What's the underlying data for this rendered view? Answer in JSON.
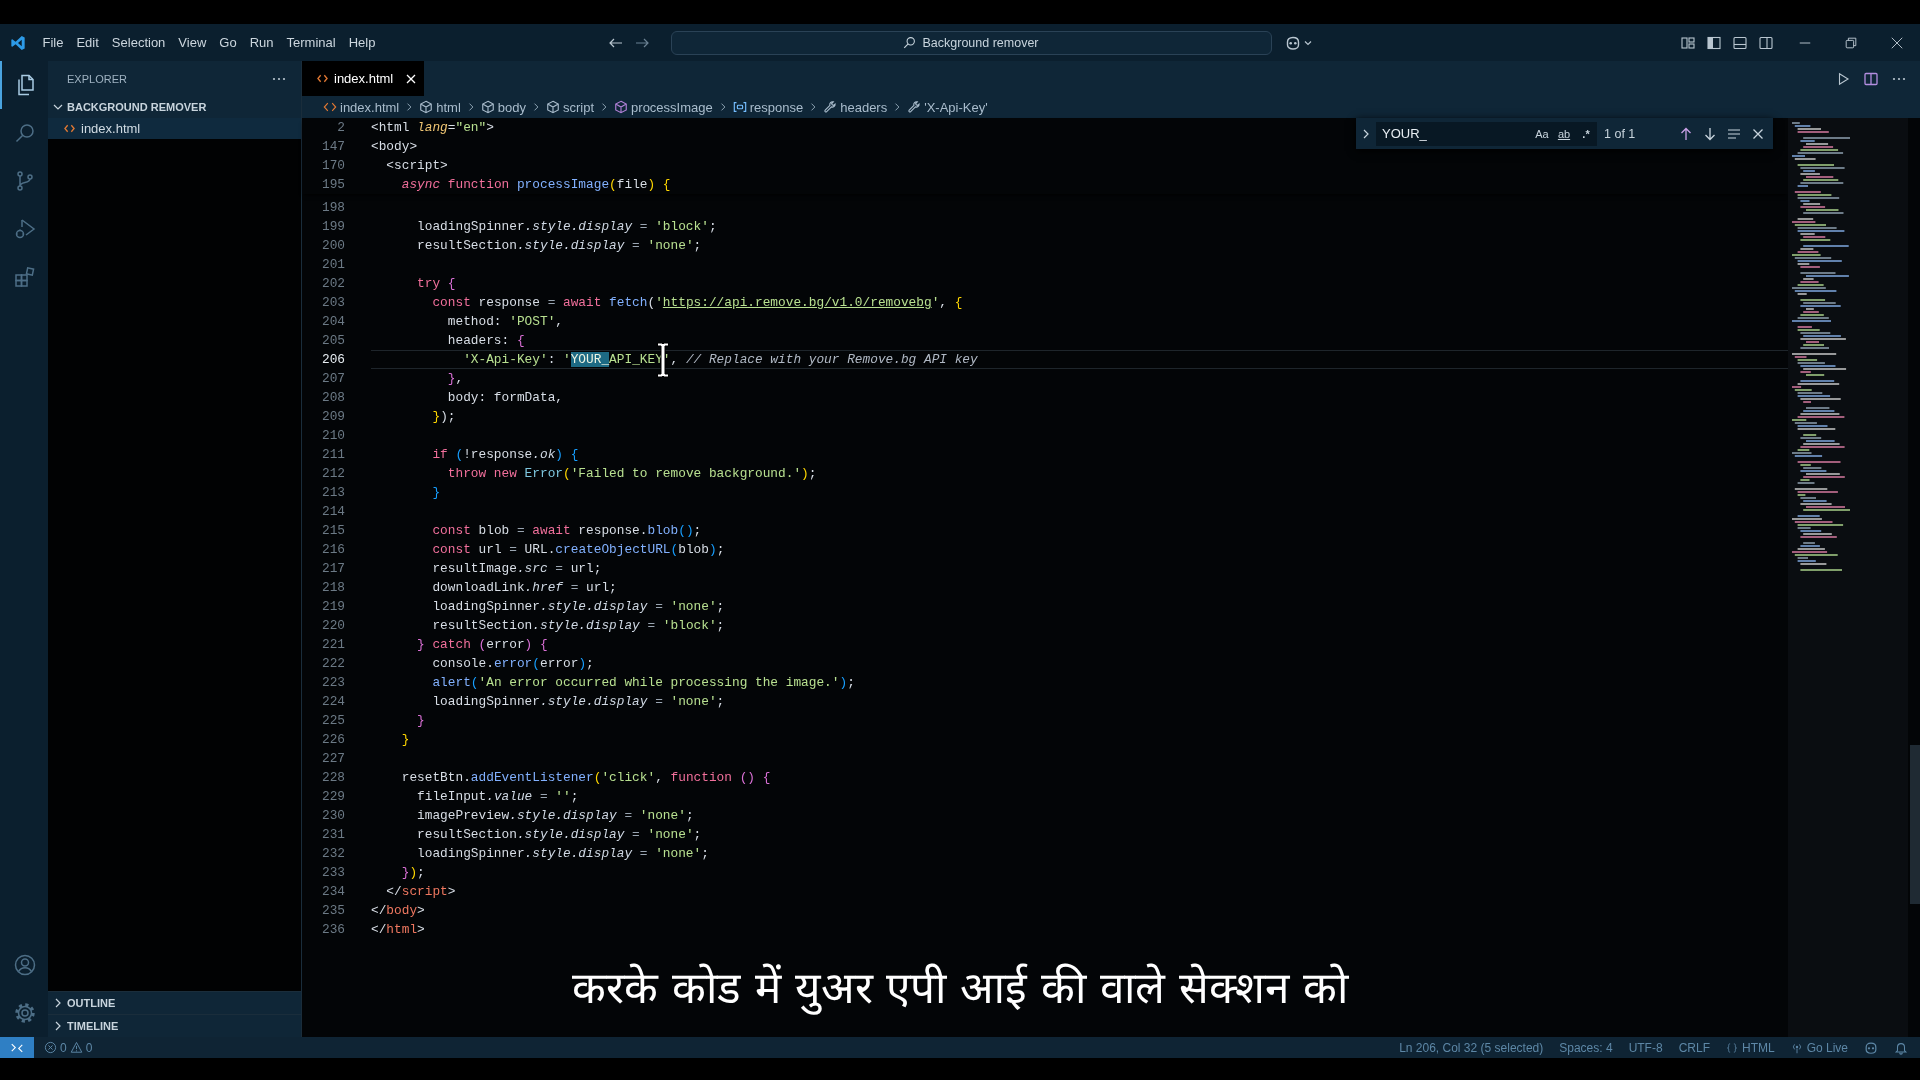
{
  "window": {
    "title": "Background remover"
  },
  "menu": [
    "File",
    "Edit",
    "Selection",
    "View",
    "Go",
    "Run",
    "Terminal",
    "Help"
  ],
  "activity_bar": {
    "items": [
      {
        "kind": "explorer",
        "selected": true
      },
      {
        "kind": "search",
        "selected": false
      },
      {
        "kind": "source-control",
        "selected": false
      },
      {
        "kind": "run",
        "selected": false
      },
      {
        "kind": "extensions",
        "selected": false
      }
    ],
    "bottom": [
      {
        "kind": "account"
      },
      {
        "kind": "settings"
      }
    ]
  },
  "sidebar": {
    "title": "EXPLORER",
    "folder": {
      "name": "BACKGROUND REMOVER",
      "expanded": true,
      "children": [
        {
          "name": "index.html",
          "selected": true
        }
      ]
    },
    "sections": [
      {
        "name": "OUTLINE",
        "expanded": false
      },
      {
        "name": "TIMELINE",
        "expanded": false
      }
    ]
  },
  "tabs": [
    {
      "label": "index.html",
      "selected": true
    }
  ],
  "breadcrumb": [
    {
      "label": "index.html",
      "kind": "file"
    },
    {
      "label": "html",
      "kind": "element"
    },
    {
      "label": "body",
      "kind": "element"
    },
    {
      "label": "script",
      "kind": "element"
    },
    {
      "label": "processImage",
      "kind": "function"
    },
    {
      "label": "response",
      "kind": "variable"
    },
    {
      "label": "headers",
      "kind": "property"
    },
    {
      "label": "'X-Api-Key'",
      "kind": "property"
    }
  ],
  "find_widget": {
    "replace_expanded": false,
    "value": "YOUR_",
    "options": [
      {
        "kind": "case",
        "label": "Aa",
        "on": false
      },
      {
        "kind": "word",
        "label": "ab",
        "on": false
      },
      {
        "kind": "regex",
        "label": ".*",
        "on": false
      }
    ],
    "result": "1 of 1"
  },
  "editor": {
    "sticky_lines": [
      {
        "number": "2",
        "tokens": [
          {
            "text": "<html",
            "kind": "plain"
          },
          {
            "text": " lang",
            "kind": "attr"
          },
          {
            "text": "=",
            "kind": "plain"
          },
          {
            "text": "\"en\"",
            "kind": "str"
          },
          {
            "text": ">",
            "kind": "plain"
          }
        ]
      },
      {
        "number": "147",
        "tokens": [
          {
            "text": "<body>",
            "kind": "plain"
          }
        ]
      },
      {
        "number": "170",
        "tokens": [
          {
            "text": "  <script>",
            "kind": "plain"
          }
        ]
      },
      {
        "number": "195",
        "tokens": [
          {
            "text": "    async",
            "kind": "kwi"
          },
          {
            "text": " function",
            "kind": "kw"
          },
          {
            "text": " processImage",
            "kind": "fn"
          },
          {
            "text": "(",
            "kind": "b1"
          },
          {
            "text": "file",
            "kind": "plain"
          },
          {
            "text": ")",
            "kind": "b1"
          },
          {
            "text": " {",
            "kind": "b1"
          }
        ]
      }
    ],
    "lines": [
      {
        "number": "198",
        "current": false
      },
      {
        "number": "199",
        "current": false,
        "tokens": [
          {
            "text": "      loadingSpinner",
            "kind": "plain"
          },
          {
            "text": ".style.display",
            "kind": "prop"
          },
          {
            "text": " = ",
            "kind": "op"
          },
          {
            "text": "'block'",
            "kind": "str"
          },
          {
            "text": ";",
            "kind": "plain"
          }
        ]
      },
      {
        "number": "200",
        "current": false,
        "tokens": [
          {
            "text": "      resultSection",
            "kind": "plain"
          },
          {
            "text": ".style.display",
            "kind": "prop"
          },
          {
            "text": " = ",
            "kind": "op"
          },
          {
            "text": "'none'",
            "kind": "str"
          },
          {
            "text": ";",
            "kind": "plain"
          }
        ]
      },
      {
        "number": "201",
        "current": false
      },
      {
        "number": "202",
        "current": false,
        "tokens": [
          {
            "text": "      try",
            "kind": "kw"
          },
          {
            "text": " {",
            "kind": "b2"
          }
        ]
      },
      {
        "number": "203",
        "current": false,
        "tokens": [
          {
            "text": "        const",
            "kind": "kw"
          },
          {
            "text": " response ",
            "kind": "plain"
          },
          {
            "text": "=",
            "kind": "op"
          },
          {
            "text": " await",
            "kind": "kw"
          },
          {
            "text": " fetch",
            "kind": "fn"
          },
          {
            "text": "(",
            "kind": "plain"
          },
          {
            "text": "'",
            "kind": "str"
          },
          {
            "text": "https://api.remove.bg/v1.0/removebg",
            "kind": "url"
          },
          {
            "text": "'",
            "kind": "str"
          },
          {
            "text": ", ",
            "kind": "plain"
          },
          {
            "text": "{",
            "kind": "b1"
          }
        ]
      },
      {
        "number": "204",
        "current": false,
        "tokens": [
          {
            "text": "          method: ",
            "kind": "plain"
          },
          {
            "text": "'POST'",
            "kind": "str"
          },
          {
            "text": ",",
            "kind": "plain"
          }
        ]
      },
      {
        "number": "205",
        "current": false,
        "tokens": [
          {
            "text": "          headers: ",
            "kind": "plain"
          },
          {
            "text": "{",
            "kind": "b2"
          }
        ]
      },
      {
        "number": "206",
        "current": true,
        "tokens": [
          {
            "text": "            'X-Api-Key'",
            "kind": "str"
          },
          {
            "text": ": ",
            "kind": "plain"
          },
          {
            "text": "'",
            "kind": "str"
          },
          {
            "text": "YOUR_",
            "kind": "match"
          },
          {
            "text": "API_KEY'",
            "kind": "str"
          },
          {
            "text": ", ",
            "kind": "plain"
          },
          {
            "text": "// Replace with your Remove.bg API key",
            "kind": "cmt"
          }
        ]
      },
      {
        "number": "207",
        "current": false,
        "tokens": [
          {
            "text": "          }",
            "kind": "b2"
          },
          {
            "text": ",",
            "kind": "plain"
          }
        ]
      },
      {
        "number": "208",
        "current": false,
        "tokens": [
          {
            "text": "          body: formData,",
            "kind": "plain"
          }
        ]
      },
      {
        "number": "209",
        "current": false,
        "tokens": [
          {
            "text": "        }",
            "kind": "b1"
          },
          {
            "text": ");",
            "kind": "plain"
          }
        ]
      },
      {
        "number": "210",
        "current": false
      },
      {
        "number": "211",
        "current": false,
        "tokens": [
          {
            "text": "        if",
            "kind": "kw"
          },
          {
            "text": " (",
            "kind": "b3"
          },
          {
            "text": "!response",
            "kind": "plain"
          },
          {
            "text": ".ok",
            "kind": "prop"
          },
          {
            "text": ")",
            "kind": "b3"
          },
          {
            "text": " {",
            "kind": "b3"
          }
        ]
      },
      {
        "number": "212",
        "current": false,
        "tokens": [
          {
            "text": "          throw new",
            "kind": "kw"
          },
          {
            "text": " Error",
            "kind": "cls"
          },
          {
            "text": "(",
            "kind": "b1"
          },
          {
            "text": "'Failed to remove background.'",
            "kind": "str"
          },
          {
            "text": ")",
            "kind": "b1"
          },
          {
            "text": ";",
            "kind": "plain"
          }
        ]
      },
      {
        "number": "213",
        "current": false,
        "tokens": [
          {
            "text": "        }",
            "kind": "b3"
          }
        ]
      },
      {
        "number": "214",
        "current": false
      },
      {
        "number": "215",
        "current": false,
        "tokens": [
          {
            "text": "        const",
            "kind": "kw"
          },
          {
            "text": " blob ",
            "kind": "plain"
          },
          {
            "text": "=",
            "kind": "op"
          },
          {
            "text": " await",
            "kind": "kw"
          },
          {
            "text": " response.",
            "kind": "plain"
          },
          {
            "text": "blob",
            "kind": "fn"
          },
          {
            "text": "()",
            "kind": "b3"
          },
          {
            "text": ";",
            "kind": "plain"
          }
        ]
      },
      {
        "number": "216",
        "current": false,
        "tokens": [
          {
            "text": "        const",
            "kind": "kw"
          },
          {
            "text": " url ",
            "kind": "plain"
          },
          {
            "text": "=",
            "kind": "op"
          },
          {
            "text": " URL.",
            "kind": "plain"
          },
          {
            "text": "createObjectURL",
            "kind": "fn"
          },
          {
            "text": "(",
            "kind": "b3"
          },
          {
            "text": "blob",
            "kind": "plain"
          },
          {
            "text": ")",
            "kind": "b3"
          },
          {
            "text": ";",
            "kind": "plain"
          }
        ]
      },
      {
        "number": "217",
        "current": false,
        "tokens": [
          {
            "text": "        resultImage",
            "kind": "plain"
          },
          {
            "text": ".src",
            "kind": "prop"
          },
          {
            "text": " = ",
            "kind": "op"
          },
          {
            "text": "url;",
            "kind": "plain"
          }
        ]
      },
      {
        "number": "218",
        "current": false,
        "tokens": [
          {
            "text": "        downloadLink",
            "kind": "plain"
          },
          {
            "text": ".href",
            "kind": "prop"
          },
          {
            "text": " = ",
            "kind": "op"
          },
          {
            "text": "url;",
            "kind": "plain"
          }
        ]
      },
      {
        "number": "219",
        "current": false,
        "tokens": [
          {
            "text": "        loadingSpinner",
            "kind": "plain"
          },
          {
            "text": ".style.display",
            "kind": "prop"
          },
          {
            "text": " = ",
            "kind": "op"
          },
          {
            "text": "'none'",
            "kind": "str"
          },
          {
            "text": ";",
            "kind": "plain"
          }
        ]
      },
      {
        "number": "220",
        "current": false,
        "tokens": [
          {
            "text": "        resultSection",
            "kind": "plain"
          },
          {
            "text": ".style.display",
            "kind": "prop"
          },
          {
            "text": " = ",
            "kind": "op"
          },
          {
            "text": "'block'",
            "kind": "str"
          },
          {
            "text": ";",
            "kind": "plain"
          }
        ]
      },
      {
        "number": "221",
        "current": false,
        "tokens": [
          {
            "text": "      }",
            "kind": "b2"
          },
          {
            "text": " catch",
            "kind": "kw"
          },
          {
            "text": " (",
            "kind": "b2"
          },
          {
            "text": "error",
            "kind": "plain"
          },
          {
            "text": ")",
            "kind": "b2"
          },
          {
            "text": " {",
            "kind": "b2"
          }
        ]
      },
      {
        "number": "222",
        "current": false,
        "tokens": [
          {
            "text": "        console.",
            "kind": "plain"
          },
          {
            "text": "error",
            "kind": "fn"
          },
          {
            "text": "(",
            "kind": "b3"
          },
          {
            "text": "error",
            "kind": "plain"
          },
          {
            "text": ")",
            "kind": "b3"
          },
          {
            "text": ";",
            "kind": "plain"
          }
        ]
      },
      {
        "number": "223",
        "current": false,
        "tokens": [
          {
            "text": "        alert",
            "kind": "fn"
          },
          {
            "text": "(",
            "kind": "b3"
          },
          {
            "text": "'An error occurred while processing the image.'",
            "kind": "str"
          },
          {
            "text": ")",
            "kind": "b3"
          },
          {
            "text": ";",
            "kind": "plain"
          }
        ]
      },
      {
        "number": "224",
        "current": false,
        "tokens": [
          {
            "text": "        loadingSpinner",
            "kind": "plain"
          },
          {
            "text": ".style.display",
            "kind": "prop"
          },
          {
            "text": " = ",
            "kind": "op"
          },
          {
            "text": "'none'",
            "kind": "str"
          },
          {
            "text": ";",
            "kind": "plain"
          }
        ]
      },
      {
        "number": "225",
        "current": false,
        "tokens": [
          {
            "text": "      }",
            "kind": "b2"
          }
        ]
      },
      {
        "number": "226",
        "current": false,
        "tokens": [
          {
            "text": "    }",
            "kind": "b1"
          }
        ]
      },
      {
        "number": "227",
        "current": false
      },
      {
        "number": "228",
        "current": false,
        "tokens": [
          {
            "text": "    resetBtn.",
            "kind": "plain"
          },
          {
            "text": "addEventListener",
            "kind": "fn"
          },
          {
            "text": "(",
            "kind": "b1"
          },
          {
            "text": "'click'",
            "kind": "str"
          },
          {
            "text": ", ",
            "kind": "plain"
          },
          {
            "text": "function",
            "kind": "kw"
          },
          {
            "text": " ()",
            "kind": "b2"
          },
          {
            "text": " {",
            "kind": "b2"
          }
        ]
      },
      {
        "number": "229",
        "current": false,
        "tokens": [
          {
            "text": "      fileInput",
            "kind": "plain"
          },
          {
            "text": ".value",
            "kind": "prop"
          },
          {
            "text": " = ",
            "kind": "op"
          },
          {
            "text": "''",
            "kind": "str"
          },
          {
            "text": ";",
            "kind": "plain"
          }
        ]
      },
      {
        "number": "230",
        "current": false,
        "tokens": [
          {
            "text": "      imagePreview",
            "kind": "plain"
          },
          {
            "text": ".style.display",
            "kind": "prop"
          },
          {
            "text": " = ",
            "kind": "op"
          },
          {
            "text": "'none'",
            "kind": "str"
          },
          {
            "text": ";",
            "kind": "plain"
          }
        ]
      },
      {
        "number": "231",
        "current": false,
        "tokens": [
          {
            "text": "      resultSection",
            "kind": "plain"
          },
          {
            "text": ".style.display",
            "kind": "prop"
          },
          {
            "text": " = ",
            "kind": "op"
          },
          {
            "text": "'none'",
            "kind": "str"
          },
          {
            "text": ";",
            "kind": "plain"
          }
        ]
      },
      {
        "number": "232",
        "current": false,
        "tokens": [
          {
            "text": "      loadingSpinner",
            "kind": "plain"
          },
          {
            "text": ".style.display",
            "kind": "prop"
          },
          {
            "text": " = ",
            "kind": "op"
          },
          {
            "text": "'none'",
            "kind": "str"
          },
          {
            "text": ";",
            "kind": "plain"
          }
        ]
      },
      {
        "number": "233",
        "current": false,
        "tokens": [
          {
            "text": "    }",
            "kind": "b2"
          },
          {
            "text": ")",
            "kind": "b1"
          },
          {
            "text": ";",
            "kind": "plain"
          }
        ]
      },
      {
        "number": "234",
        "current": false,
        "tokens": [
          {
            "text": "  </",
            "kind": "plain"
          },
          {
            "text": "script",
            "kind": "tag"
          },
          {
            "text": ">",
            "kind": "plain"
          }
        ]
      },
      {
        "number": "235",
        "current": false,
        "tokens": [
          {
            "text": "</",
            "kind": "plain"
          },
          {
            "text": "body",
            "kind": "tag"
          },
          {
            "text": ">",
            "kind": "plain"
          }
        ]
      },
      {
        "number": "236",
        "current": false,
        "tokens": [
          {
            "text": "</",
            "kind": "plain"
          },
          {
            "text": "html",
            "kind": "tag"
          },
          {
            "text": ">",
            "kind": "plain"
          }
        ]
      }
    ]
  },
  "status_bar": {
    "errors": "0",
    "warnings": "0",
    "items": [
      {
        "kind": "text",
        "label": "Ln 206, Col 32 (5 selected)"
      },
      {
        "kind": "text",
        "label": "Spaces: 4"
      },
      {
        "kind": "text",
        "label": "UTF-8"
      },
      {
        "kind": "text",
        "label": "CRLF"
      },
      {
        "kind": "language",
        "label": "HTML"
      },
      {
        "kind": "live",
        "label": "Go Live"
      },
      {
        "kind": "bot"
      },
      {
        "kind": "bell"
      }
    ]
  },
  "subtitle": "करके कोड में युअर एपी आई की वाले सेक्शन को"
}
